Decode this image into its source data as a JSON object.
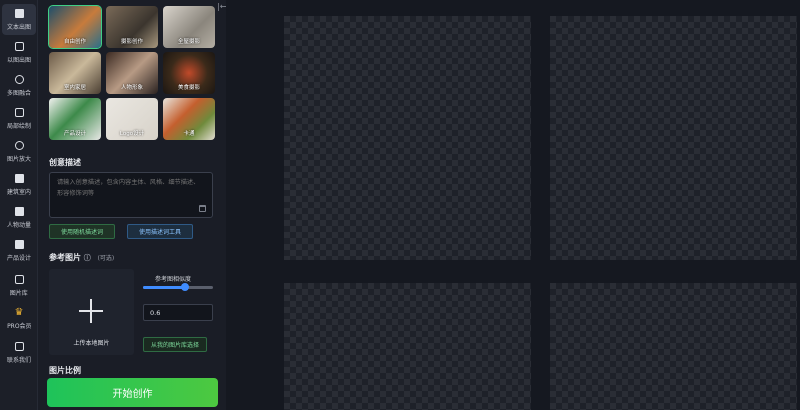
{
  "nav": [
    {
      "label": "文本出图",
      "icon": "document-icon",
      "active": true
    },
    {
      "label": "以图出图",
      "icon": "image-icon"
    },
    {
      "label": "多图融合",
      "icon": "merge-icon"
    },
    {
      "label": "局部绘制",
      "icon": "brush-icon"
    },
    {
      "label": "图片放大",
      "icon": "zoom-icon"
    },
    {
      "label": "建筑室内",
      "icon": "building-icon"
    },
    {
      "label": "人物动量",
      "icon": "person-icon"
    },
    {
      "label": "产品设计",
      "icon": "product-icon"
    },
    {
      "label": "图片库",
      "icon": "database-icon"
    },
    {
      "label": "PRO会员",
      "icon": "crown-icon"
    },
    {
      "label": "联系我们",
      "icon": "chat-icon"
    }
  ],
  "styles": [
    {
      "label": "自由创作",
      "selected": true,
      "bg": "linear-gradient(135deg,#1d4e6b,#c77b3c 55%,#2a6f8a)"
    },
    {
      "label": "摄影创作",
      "bg": "linear-gradient(135deg,#7a6a58,#3b352e 60%,#a8987f)"
    },
    {
      "label": "全屋摄影",
      "bg": "linear-gradient(135deg,#d9d4cc,#8a857c 60%,#b5afa4)"
    },
    {
      "label": "室内家居",
      "bg": "linear-gradient(135deg,#6b5a48,#c9b89a 50%,#4a3e32)"
    },
    {
      "label": "人物形象",
      "bg": "linear-gradient(135deg,#3b2a22,#b79a84 50%,#2a2220)"
    },
    {
      "label": "美食摄影",
      "bg": "radial-gradient(circle at 50% 50%,#c04a2a,#3b2a1a 55%,#1b1612)"
    },
    {
      "label": "产品设计",
      "bg": "linear-gradient(135deg,#f2f2f0,#3d8a4a 45%,#e8e8e6)"
    },
    {
      "label": "Logo设计",
      "bg": "linear-gradient(135deg,#eae7e1,#d7d2c9)"
    },
    {
      "label": "卡通",
      "bg": "linear-gradient(135deg,#e9e6de,#c45f2e 40%,#6f8a3b 70%,#e2ddd2)"
    }
  ],
  "description": {
    "title": "创意描述",
    "placeholder": "请输入创意描述，包含内容主体、风格、细节描述、形容修饰词等"
  },
  "buttons": {
    "random": "使用随机描述词",
    "tool": "使用描述词工具",
    "from_library": "从我的图片库选择",
    "start": "开始创作"
  },
  "reference": {
    "title": "参考图片",
    "optional": "(可选)",
    "upload_label": "上传本地图片",
    "slider_label": "参考图相似度",
    "similarity": 0.6,
    "value_text": "0.6"
  },
  "ratio": {
    "title": "图片比例"
  },
  "theme": {
    "accent": "#1ec35a",
    "link_blue": "#3f8cff"
  }
}
